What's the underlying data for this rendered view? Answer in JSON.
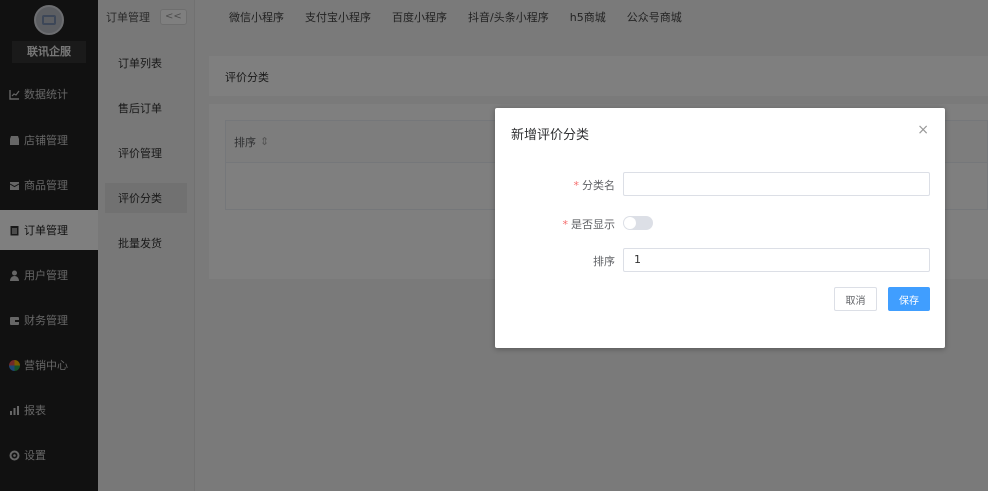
{
  "brand": {
    "name": "联讯企服"
  },
  "sidebar": {
    "items": [
      {
        "label": "数据统计",
        "icon": "chart-line-icon"
      },
      {
        "label": "店铺管理",
        "icon": "store-icon"
      },
      {
        "label": "商品管理",
        "icon": "goods-box-icon"
      },
      {
        "label": "订单管理",
        "icon": "order-clipboard-icon"
      },
      {
        "label": "用户管理",
        "icon": "user-icon"
      },
      {
        "label": "财务管理",
        "icon": "finance-wallet-icon"
      },
      {
        "label": "营销中心",
        "icon": "marketing-pinwheel-icon"
      },
      {
        "label": "报表",
        "icon": "report-bars-icon"
      },
      {
        "label": "设置",
        "icon": "settings-gear-icon"
      }
    ]
  },
  "subnav": {
    "title": "订单管理",
    "collapse": "<<",
    "items": [
      "订单列表",
      "售后订单",
      "评价管理",
      "评价分类",
      "批量发货"
    ]
  },
  "topbar": {
    "tabs": [
      "微信小程序",
      "支付宝小程序",
      "百度小程序",
      "抖音/头条小程序",
      "h5商城",
      "公众号商城"
    ]
  },
  "main": {
    "header": "评价分类",
    "table": {
      "sort_column": "排序",
      "sort_icon": "⇕"
    }
  },
  "dialog": {
    "title": "新增评价分类",
    "close": "×",
    "fields": {
      "name": {
        "label": "分类名",
        "value": ""
      },
      "visible": {
        "label": "是否显示",
        "on": false
      },
      "sort": {
        "label": "排序",
        "value": "1"
      }
    },
    "cancel": "取消",
    "save": "保存"
  },
  "colors": {
    "primary": "#409eff",
    "sidebar_bg": "#222222",
    "required": "#f56c6c"
  }
}
